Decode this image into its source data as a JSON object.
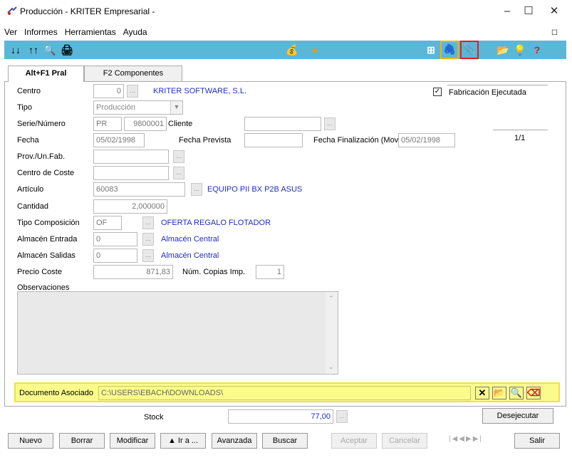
{
  "window": {
    "title": "Producción - KRITER Empresarial -",
    "minimize": "–",
    "maximize": "☐",
    "close": "✕"
  },
  "menu": [
    "Ver",
    "Informes",
    "Herramientas",
    "Ayuda"
  ],
  "tabs": [
    {
      "label": "Alt+F1 Pral",
      "active": true
    },
    {
      "label": "F2 Componentes",
      "active": false
    }
  ],
  "form": {
    "centro": {
      "label": "Centro",
      "value": "0",
      "name": "KRITER SOFTWARE, S.L."
    },
    "fabricacion": {
      "label": "Fabricación Ejecutada",
      "checked": true
    },
    "tipo": {
      "label": "Tipo",
      "value": "Producción"
    },
    "serie": {
      "label": "Serie/Número",
      "serie": "PR",
      "numero": "9800001",
      "cliente_label": "Cliente",
      "cliente": ""
    },
    "pager": "1/1",
    "fecha": {
      "label": "Fecha",
      "value": "05/02/1998",
      "prevista_label": "Fecha Prevista",
      "prevista": "",
      "finalizacion_label": "Fecha Finalización (Mov.",
      "finalizacion": "05/02/1998"
    },
    "prov": {
      "label": "Prov./Un.Fab.",
      "value": ""
    },
    "centro_coste": {
      "label": "Centro de Coste",
      "value": ""
    },
    "articulo": {
      "label": "Artículo",
      "value": "60083",
      "name": "EQUIPO PII BX P2B ASUS"
    },
    "cantidad": {
      "label": "Cantidad",
      "value": "2,000000"
    },
    "tipo_comp": {
      "label": "Tipo Composición",
      "value": "OF",
      "name": "OFERTA REGALO FLOTADOR"
    },
    "alm_entrada": {
      "label": "Almacén Entrada",
      "value": "0",
      "name": "Almacén Central"
    },
    "alm_salidas": {
      "label": "Almacén Salidas",
      "value": "0",
      "name": "Almacén Central"
    },
    "precio": {
      "label": "Precio Coste",
      "value": "871,83",
      "copias_label": "Núm. Copias Imp.",
      "copias": "1"
    },
    "observaciones": {
      "label": "Observaciones",
      "value": ""
    },
    "documento": {
      "label": "Documento Asociado",
      "value": "C:\\USERS\\EBACH\\DOWNLOADS\\"
    }
  },
  "stock": {
    "label": "Stock",
    "value": "77,00",
    "desejecutar": "Desejecutar"
  },
  "buttons": {
    "nuevo": "Nuevo",
    "borrar": "Borrar",
    "modificar": "Modificar",
    "ira": "▲ Ir a ...",
    "avanzada": "Avanzada",
    "buscar": "Buscar",
    "aceptar": "Aceptar",
    "cancelar": "Cancelar",
    "salir": "Salir"
  },
  "colors": {
    "toolbar": "#5bb7d8",
    "highlight_yellow": "#f0b400",
    "highlight_red": "#e0201c",
    "doc_bg": "#fbfb8c",
    "link_blue": "#1f2dbf"
  }
}
